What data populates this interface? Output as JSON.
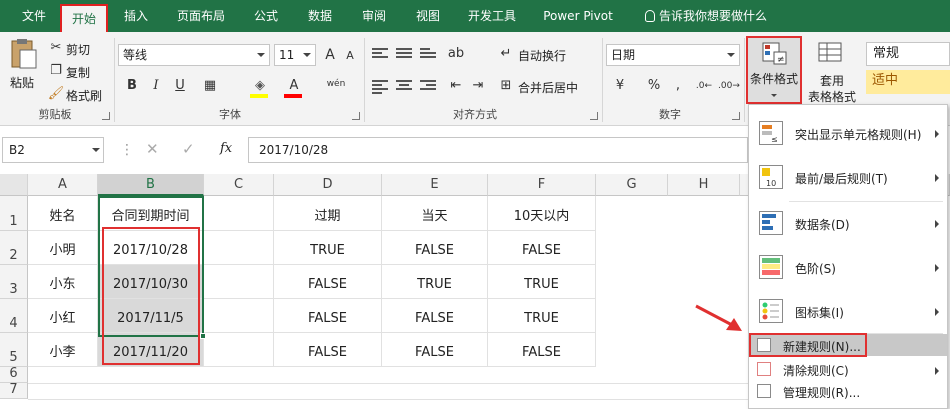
{
  "tabs": [
    "文件",
    "开始",
    "插入",
    "页面布局",
    "公式",
    "数据",
    "审阅",
    "视图",
    "开发工具",
    "Power Pivot"
  ],
  "tell_me": "告诉我你想要做什么",
  "ribbon": {
    "paste": "粘贴",
    "cut": "剪切",
    "copy": "复制",
    "format_painter": "格式刷",
    "clipboard_group": "剪贴板",
    "font_name": "等线",
    "font_size": "11",
    "bold": "B",
    "italic": "I",
    "underline": "U",
    "phonetic": "wén",
    "font_group": "字体",
    "wrap_text": "自动换行",
    "merge_center": "合并后居中",
    "align_group": "对齐方式",
    "number_format": "日期",
    "percent": "%",
    "comma": ",",
    "number_group": "数字",
    "cond_format": "条件格式",
    "table_format_1": "套用",
    "table_format_2": "表格格式",
    "style_normal": "常规",
    "style_neutral": "适中"
  },
  "formula_bar": {
    "name_box": "B2",
    "fx": "fx",
    "value": "2017/10/28"
  },
  "columns": [
    "A",
    "B",
    "C",
    "D",
    "E",
    "F",
    "G",
    "H"
  ],
  "rows": [
    "1",
    "2",
    "3",
    "4",
    "5",
    "6",
    "7"
  ],
  "cells": {
    "r1": [
      "姓名",
      "合同到期时间",
      "",
      "过期",
      "当天",
      "10天以内"
    ],
    "r2": [
      "小明",
      "2017/10/28",
      "",
      "TRUE",
      "FALSE",
      "FALSE"
    ],
    "r3": [
      "小东",
      "2017/10/30",
      "",
      "FALSE",
      "TRUE",
      "TRUE"
    ],
    "r4": [
      "小红",
      "2017/11/5",
      "",
      "FALSE",
      "FALSE",
      "TRUE"
    ],
    "r5": [
      "小李",
      "2017/11/20",
      "",
      "FALSE",
      "FALSE",
      "FALSE"
    ]
  },
  "menu": {
    "highlight_rules": "突出显示单元格规则(H)",
    "top_bottom": "最前/最后规则(T)",
    "data_bars": "数据条(D)",
    "color_scales": "色阶(S)",
    "icon_sets": "图标集(I)",
    "new_rule": "新建规则(N)...",
    "clear_rules": "清除规则(C)",
    "manage_rules": "管理规则(R)..."
  },
  "colors": {
    "excel_green": "#217346",
    "highlight_red": "#e03030",
    "neutral_style": "#ffeb9c"
  }
}
